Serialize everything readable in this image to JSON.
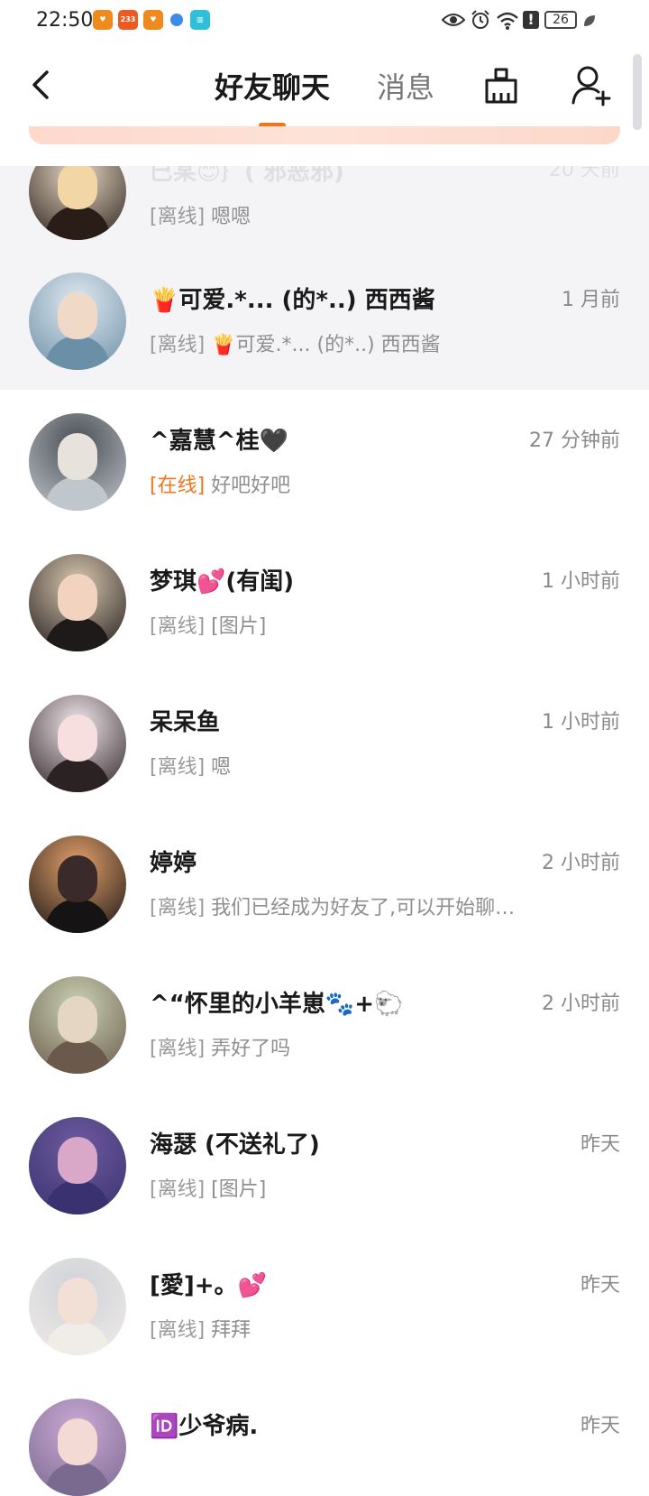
{
  "status_bar": {
    "time": "22:50",
    "badge_233": "233",
    "battery": "26",
    "icons": [
      "heart-app-icon",
      "bilibili-233-icon",
      "heart-app-icon",
      "planet-icon",
      "book-icon",
      "eye-icon",
      "alarm-icon",
      "wifi-icon",
      "alert-icon",
      "battery-icon",
      "leaf-icon"
    ]
  },
  "header": {
    "tab_active": "好友聊天",
    "tab_inactive": "消息",
    "accent_color": "#f2751d"
  },
  "chats": [
    {
      "name": "",
      "time": "",
      "status": "[离线]",
      "preview": "嗯嗯",
      "pinned": true,
      "cut": true
    },
    {
      "name": "🍟可爱.*... (的*..) 西西酱",
      "time": "1 月前",
      "status": "[离线]",
      "preview": "🍟可爱.*... (的*..) 西西酱",
      "pinned": true
    },
    {
      "name": "^嘉慧^桂🖤",
      "time": "27 分钟前",
      "status": "[在线]",
      "online": true,
      "preview": "好吧好吧"
    },
    {
      "name": "梦琪💕(有闺)",
      "time": "1 小时前",
      "status": "[离线]",
      "preview": "[图片]"
    },
    {
      "name": "呆呆鱼",
      "time": "1 小时前",
      "status": "[离线]",
      "preview": "嗯"
    },
    {
      "name": "婷婷",
      "time": "2 小时前",
      "status": "[离线]",
      "preview": "我们已经成为好友了,可以开始聊…"
    },
    {
      "name": "^“怀里的小羊崽🐾+🐑",
      "time": "2 小时前",
      "status": "[离线]",
      "preview": "弄好了吗"
    },
    {
      "name": "海瑟 (不送礼了)",
      "time": "昨天",
      "status": "[离线]",
      "preview": "[图片]"
    },
    {
      "name": "[愛]+。💕",
      "time": "昨天",
      "status": "[离线]",
      "preview": "拜拜"
    },
    {
      "name": "🆔少爷病.",
      "time": "昨天",
      "status": "",
      "preview": ""
    }
  ]
}
